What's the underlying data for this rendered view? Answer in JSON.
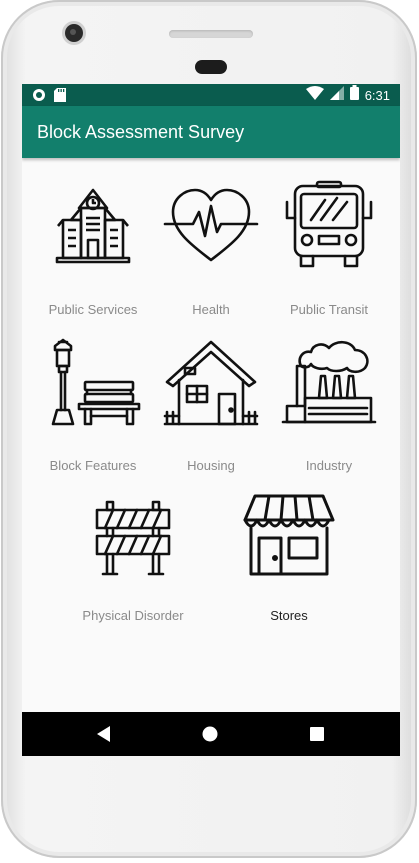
{
  "status_bar": {
    "time": "6:31",
    "left_icons": [
      "circle-notification-icon",
      "sd-card-icon"
    ],
    "right_icons": [
      "wifi-icon",
      "signal-icon",
      "battery-icon"
    ]
  },
  "app_bar": {
    "title": "Block Assessment Survey",
    "color": "#127f6c",
    "status_color": "#0a5c4e"
  },
  "categories": [
    {
      "label": "Public Services",
      "icon": "public-services-building-icon"
    },
    {
      "label": "Health",
      "icon": "heartbeat-icon"
    },
    {
      "label": "Public Transit",
      "icon": "bus-icon"
    },
    {
      "label": "Block Features",
      "icon": "streetlamp-bench-icon"
    },
    {
      "label": "Housing",
      "icon": "house-icon"
    },
    {
      "label": "Industry",
      "icon": "factory-icon"
    },
    {
      "label": "Physical Disorder",
      "icon": "barricade-icon"
    },
    {
      "label": "Stores",
      "icon": "storefront-icon"
    }
  ],
  "nav_bar": {
    "buttons": [
      "back-icon",
      "home-icon",
      "recents-icon"
    ]
  }
}
